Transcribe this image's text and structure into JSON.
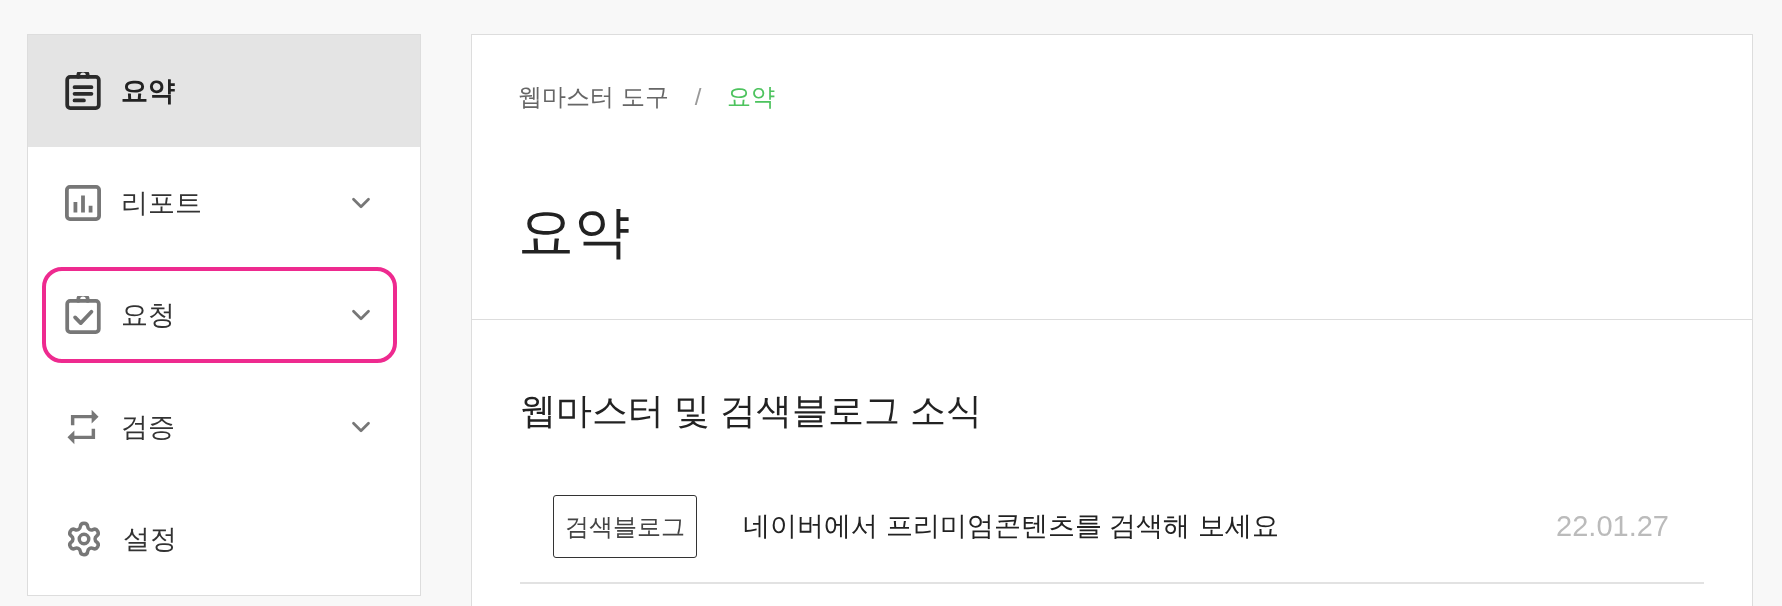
{
  "sidebar": {
    "items": [
      {
        "label": "요약",
        "selected": true,
        "expandable": false,
        "highlighted": false
      },
      {
        "label": "리포트",
        "selected": false,
        "expandable": true,
        "highlighted": false
      },
      {
        "label": "요청",
        "selected": false,
        "expandable": true,
        "highlighted": true
      },
      {
        "label": "검증",
        "selected": false,
        "expandable": true,
        "highlighted": false
      },
      {
        "label": "설정",
        "selected": false,
        "expandable": false,
        "highlighted": false
      }
    ]
  },
  "breadcrumb": {
    "separator": "/",
    "items": [
      {
        "label": "웹마스터 도구",
        "current": false
      },
      {
        "label": "요약",
        "current": true
      }
    ]
  },
  "page_title": "요약",
  "news": {
    "title": "웹마스터 및 검색블로그 소식",
    "items": [
      {
        "tag": "검색블로그",
        "text": "네이버에서 프리미엄콘텐츠를 검색해 보세요",
        "date": "22.01.27"
      }
    ]
  }
}
